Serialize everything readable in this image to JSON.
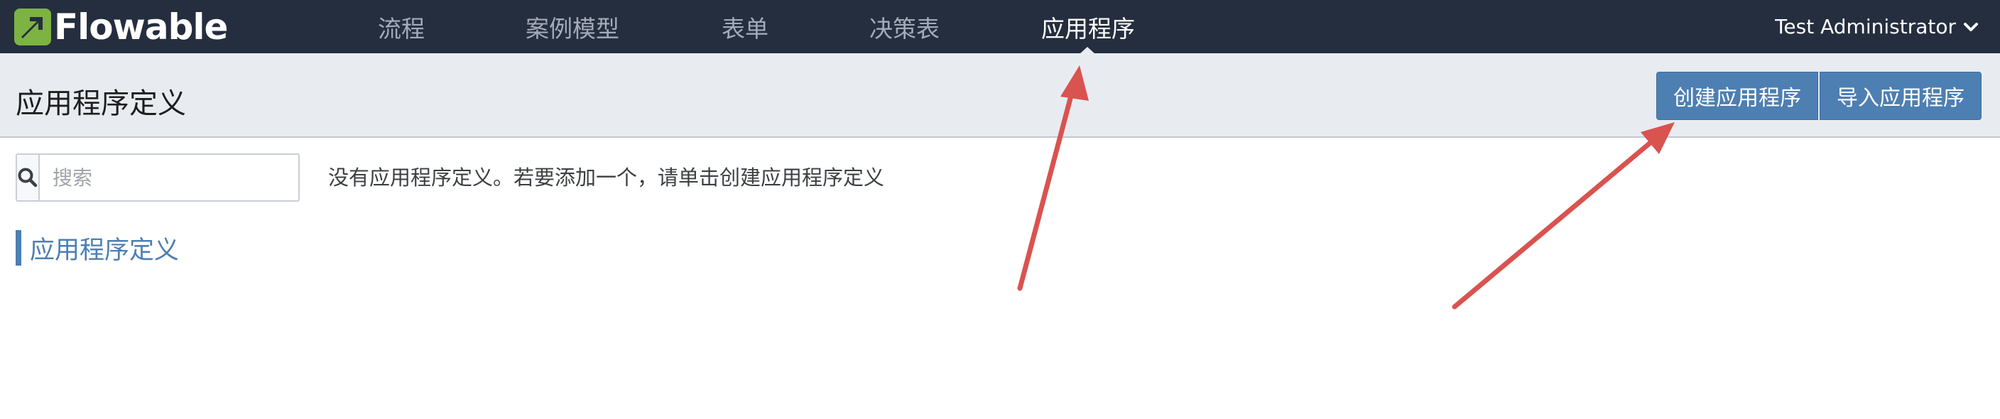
{
  "app": {
    "logo_text": "Flowable"
  },
  "nav": {
    "items": [
      {
        "label": "流程"
      },
      {
        "label": "案例模型"
      },
      {
        "label": "表单"
      },
      {
        "label": "决策表"
      },
      {
        "label": "应用程序"
      }
    ],
    "active_index": 4,
    "user": "Test Administrator"
  },
  "page": {
    "title": "应用程序定义",
    "create_button": "创建应用程序",
    "import_button": "导入应用程序"
  },
  "search": {
    "placeholder": "搜索",
    "value": ""
  },
  "empty_message": "没有应用程序定义。若要添加一个，请单击创建应用程序定义",
  "section_title": "应用程序定义",
  "colors": {
    "navbar": "#252e3f",
    "accent": "#4d7fb2",
    "logo_green": "#7cb342",
    "annotation_arrow": "#d9534f"
  }
}
